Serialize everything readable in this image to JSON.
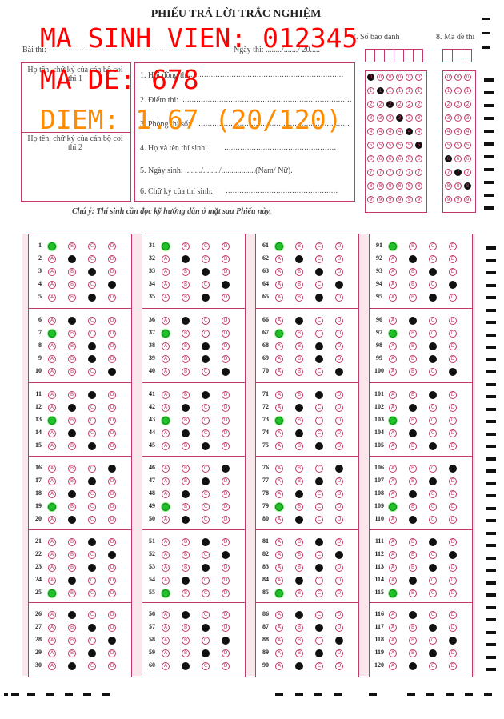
{
  "header": {
    "title": "PHIẾU TRẢ LỜI TRẮC NGHIỆM",
    "exam_label": "Bài thi:",
    "exam_date_label": "Ngày thi: ......../......./ 20.....",
    "sbd_label": "7. Số báo danh",
    "made_label": "8. Mã đề thi"
  },
  "proctor": {
    "proctor1": "Họ tên, chữ ký của cán bộ coi thi 1",
    "proctor2": "Họ tên, chữ ký của cán bộ coi thi 2"
  },
  "info_fields": [
    "1. Hội đồng thi:",
    "2. Điểm thi:",
    "3. Phòng thi số:",
    "4. Họ và tên thí sinh:",
    "5. Ngày sinh: ......../......../.................(Nam/ Nữ).",
    "6. Chữ ký của thí sinh:"
  ],
  "note": "Chú ý: Thí sinh cần đọc kỹ hướng dẫn ở mặt sau Phiếu này.",
  "overlay": {
    "student_id": "MA SINH VIEN: 012345",
    "exam_code": "MA DE: 678",
    "score": "DIEM: 1.67 (20/120)",
    "colors": {
      "id": "#ff0000",
      "score": "#ff8c00",
      "correct": "#22c02a"
    }
  },
  "sbd_digits": [
    0,
    1,
    2,
    3,
    4,
    5
  ],
  "made_digits": [
    6,
    7,
    8
  ],
  "options": [
    "A",
    "B",
    "C",
    "D"
  ],
  "answers": [
    {
      "q": 1,
      "sel": "A",
      "correct": true
    },
    {
      "q": 2,
      "sel": "B"
    },
    {
      "q": 3,
      "sel": "C"
    },
    {
      "q": 4,
      "sel": "D"
    },
    {
      "q": 5,
      "sel": "C"
    },
    {
      "q": 6,
      "sel": "B"
    },
    {
      "q": 7,
      "sel": "A",
      "correct": true
    },
    {
      "q": 8,
      "sel": "C"
    },
    {
      "q": 9,
      "sel": "C"
    },
    {
      "q": 10,
      "sel": "D"
    },
    {
      "q": 11,
      "sel": "C"
    },
    {
      "q": 12,
      "sel": "B"
    },
    {
      "q": 13,
      "sel": "A",
      "correct": true
    },
    {
      "q": 14,
      "sel": "B"
    },
    {
      "q": 15,
      "sel": "C"
    },
    {
      "q": 16,
      "sel": "D"
    },
    {
      "q": 17,
      "sel": "C"
    },
    {
      "q": 18,
      "sel": "B"
    },
    {
      "q": 19,
      "sel": "A",
      "correct": true
    },
    {
      "q": 20,
      "sel": "B"
    },
    {
      "q": 21,
      "sel": "C"
    },
    {
      "q": 22,
      "sel": "D"
    },
    {
      "q": 23,
      "sel": "C"
    },
    {
      "q": 24,
      "sel": "B"
    },
    {
      "q": 25,
      "sel": "A",
      "correct": true
    },
    {
      "q": 26,
      "sel": "B"
    },
    {
      "q": 27,
      "sel": "C"
    },
    {
      "q": 28,
      "sel": "D"
    },
    {
      "q": 29,
      "sel": "C"
    },
    {
      "q": 30,
      "sel": "B"
    },
    {
      "q": 31,
      "sel": "A",
      "correct": true
    },
    {
      "q": 32,
      "sel": "B"
    },
    {
      "q": 33,
      "sel": "C"
    },
    {
      "q": 34,
      "sel": "D"
    },
    {
      "q": 35,
      "sel": "C"
    },
    {
      "q": 36,
      "sel": "B"
    },
    {
      "q": 37,
      "sel": "A",
      "correct": true
    },
    {
      "q": 38,
      "sel": "C"
    },
    {
      "q": 39,
      "sel": "C"
    },
    {
      "q": 40,
      "sel": "D"
    },
    {
      "q": 41,
      "sel": "C"
    },
    {
      "q": 42,
      "sel": "B"
    },
    {
      "q": 43,
      "sel": "A",
      "correct": true
    },
    {
      "q": 44,
      "sel": "B"
    },
    {
      "q": 45,
      "sel": "C"
    },
    {
      "q": 46,
      "sel": "D"
    },
    {
      "q": 47,
      "sel": "C"
    },
    {
      "q": 48,
      "sel": "B"
    },
    {
      "q": 49,
      "sel": "A",
      "correct": true
    },
    {
      "q": 50,
      "sel": "B"
    },
    {
      "q": 51,
      "sel": "C"
    },
    {
      "q": 52,
      "sel": "D"
    },
    {
      "q": 53,
      "sel": "C"
    },
    {
      "q": 54,
      "sel": "B"
    },
    {
      "q": 55,
      "sel": "A",
      "correct": true
    },
    {
      "q": 56,
      "sel": "B"
    },
    {
      "q": 57,
      "sel": "C"
    },
    {
      "q": 58,
      "sel": "D"
    },
    {
      "q": 59,
      "sel": "C"
    },
    {
      "q": 60,
      "sel": "B"
    },
    {
      "q": 61,
      "sel": "A",
      "correct": true
    },
    {
      "q": 62,
      "sel": "B"
    },
    {
      "q": 63,
      "sel": "C"
    },
    {
      "q": 64,
      "sel": "D"
    },
    {
      "q": 65,
      "sel": "C"
    },
    {
      "q": 66,
      "sel": "B"
    },
    {
      "q": 67,
      "sel": "A",
      "correct": true
    },
    {
      "q": 68,
      "sel": "C"
    },
    {
      "q": 69,
      "sel": "C"
    },
    {
      "q": 70,
      "sel": "D"
    },
    {
      "q": 71,
      "sel": "C"
    },
    {
      "q": 72,
      "sel": "B"
    },
    {
      "q": 73,
      "sel": "A",
      "correct": true
    },
    {
      "q": 74,
      "sel": "B"
    },
    {
      "q": 75,
      "sel": "C"
    },
    {
      "q": 76,
      "sel": "D"
    },
    {
      "q": 77,
      "sel": "C"
    },
    {
      "q": 78,
      "sel": "B"
    },
    {
      "q": 79,
      "sel": "A",
      "correct": true
    },
    {
      "q": 80,
      "sel": "B"
    },
    {
      "q": 81,
      "sel": "C"
    },
    {
      "q": 82,
      "sel": "D"
    },
    {
      "q": 83,
      "sel": "C"
    },
    {
      "q": 84,
      "sel": "B"
    },
    {
      "q": 85,
      "sel": "A",
      "correct": true
    },
    {
      "q": 86,
      "sel": "B"
    },
    {
      "q": 87,
      "sel": "C"
    },
    {
      "q": 88,
      "sel": "D"
    },
    {
      "q": 89,
      "sel": "C"
    },
    {
      "q": 90,
      "sel": "B"
    },
    {
      "q": 91,
      "sel": "A",
      "correct": true
    },
    {
      "q": 92,
      "sel": "B"
    },
    {
      "q": 93,
      "sel": "C"
    },
    {
      "q": 94,
      "sel": "D"
    },
    {
      "q": 95,
      "sel": "C"
    },
    {
      "q": 96,
      "sel": "B"
    },
    {
      "q": 97,
      "sel": "A",
      "correct": true
    },
    {
      "q": 98,
      "sel": "C"
    },
    {
      "q": 99,
      "sel": "C"
    },
    {
      "q": 100,
      "sel": "D"
    },
    {
      "q": 101,
      "sel": "C"
    },
    {
      "q": 102,
      "sel": "B"
    },
    {
      "q": 103,
      "sel": "A",
      "correct": true
    },
    {
      "q": 104,
      "sel": "B"
    },
    {
      "q": 105,
      "sel": "C"
    },
    {
      "q": 106,
      "sel": "D"
    },
    {
      "q": 107,
      "sel": "C"
    },
    {
      "q": 108,
      "sel": "B"
    },
    {
      "q": 109,
      "sel": "A",
      "correct": true
    },
    {
      "q": 110,
      "sel": "B"
    },
    {
      "q": 111,
      "sel": "C"
    },
    {
      "q": 112,
      "sel": "D"
    },
    {
      "q": 113,
      "sel": "C"
    },
    {
      "q": 114,
      "sel": "B"
    },
    {
      "q": 115,
      "sel": "A",
      "correct": true
    },
    {
      "q": 116,
      "sel": "B"
    },
    {
      "q": 117,
      "sel": "C"
    },
    {
      "q": 118,
      "sel": "D"
    },
    {
      "q": 119,
      "sel": "C"
    },
    {
      "q": 120,
      "sel": "B"
    }
  ]
}
